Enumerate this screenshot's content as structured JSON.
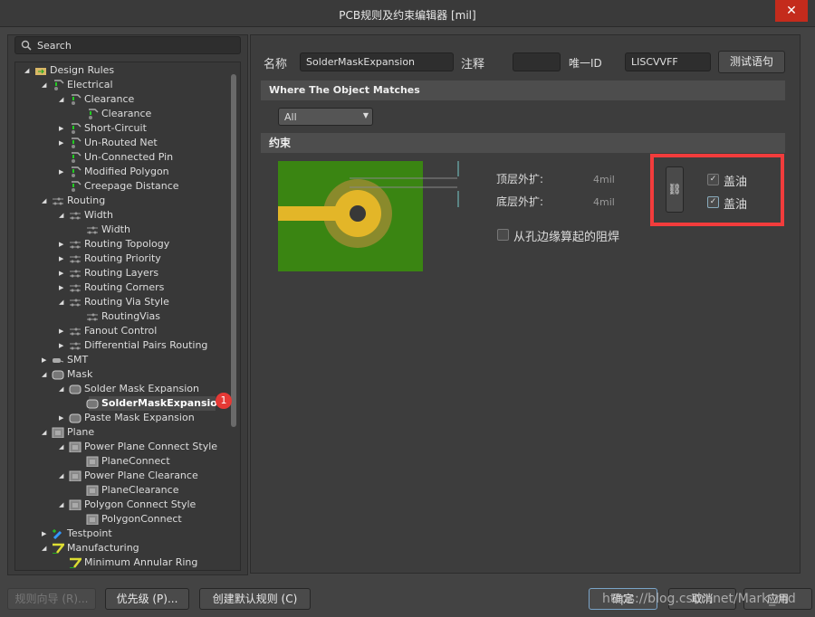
{
  "window": {
    "title": "PCB规则及约束编辑器 [mil]",
    "close": "✕"
  },
  "search": {
    "placeholder": "Search"
  },
  "tree": [
    {
      "label": "Design Rules",
      "level": 0,
      "arrow": "open",
      "icon": "folder"
    },
    {
      "label": "Electrical",
      "level": 1,
      "arrow": "open",
      "icon": "electrical"
    },
    {
      "label": "Clearance",
      "level": 2,
      "arrow": "open",
      "icon": "electrical"
    },
    {
      "label": "Clearance",
      "level": 3,
      "arrow": "none",
      "icon": "electrical"
    },
    {
      "label": "Short-Circuit",
      "level": 2,
      "arrow": "closed",
      "icon": "electrical"
    },
    {
      "label": "Un-Routed Net",
      "level": 2,
      "arrow": "closed",
      "icon": "electrical"
    },
    {
      "label": "Un-Connected Pin",
      "level": 2,
      "arrow": "none",
      "icon": "electrical"
    },
    {
      "label": "Modified Polygon",
      "level": 2,
      "arrow": "closed",
      "icon": "electrical"
    },
    {
      "label": "Creepage Distance",
      "level": 2,
      "arrow": "none",
      "icon": "electrical"
    },
    {
      "label": "Routing",
      "level": 1,
      "arrow": "open",
      "icon": "routing"
    },
    {
      "label": "Width",
      "level": 2,
      "arrow": "open",
      "icon": "routing"
    },
    {
      "label": "Width",
      "level": 3,
      "arrow": "none",
      "icon": "routing"
    },
    {
      "label": "Routing Topology",
      "level": 2,
      "arrow": "closed",
      "icon": "routing"
    },
    {
      "label": "Routing Priority",
      "level": 2,
      "arrow": "closed",
      "icon": "routing"
    },
    {
      "label": "Routing Layers",
      "level": 2,
      "arrow": "closed",
      "icon": "routing"
    },
    {
      "label": "Routing Corners",
      "level": 2,
      "arrow": "closed",
      "icon": "routing"
    },
    {
      "label": "Routing Via Style",
      "level": 2,
      "arrow": "open",
      "icon": "routing"
    },
    {
      "label": "RoutingVias",
      "level": 3,
      "arrow": "none",
      "icon": "routing"
    },
    {
      "label": "Fanout Control",
      "level": 2,
      "arrow": "closed",
      "icon": "routing"
    },
    {
      "label": "Differential Pairs Routing",
      "level": 2,
      "arrow": "closed",
      "icon": "routing"
    },
    {
      "label": "SMT",
      "level": 1,
      "arrow": "closed",
      "icon": "smt"
    },
    {
      "label": "Mask",
      "level": 1,
      "arrow": "open",
      "icon": "mask"
    },
    {
      "label": "Solder Mask Expansion",
      "level": 2,
      "arrow": "open",
      "icon": "mask"
    },
    {
      "label": "SolderMaskExpansion*",
      "level": 3,
      "arrow": "none",
      "icon": "mask",
      "selected": true
    },
    {
      "label": "Paste Mask Expansion",
      "level": 2,
      "arrow": "closed",
      "icon": "mask"
    },
    {
      "label": "Plane",
      "level": 1,
      "arrow": "open",
      "icon": "plane"
    },
    {
      "label": "Power Plane Connect Style",
      "level": 2,
      "arrow": "open",
      "icon": "plane"
    },
    {
      "label": "PlaneConnect",
      "level": 3,
      "arrow": "none",
      "icon": "plane"
    },
    {
      "label": "Power Plane Clearance",
      "level": 2,
      "arrow": "open",
      "icon": "plane"
    },
    {
      "label": "PlaneClearance",
      "level": 3,
      "arrow": "none",
      "icon": "plane"
    },
    {
      "label": "Polygon Connect Style",
      "level": 2,
      "arrow": "open",
      "icon": "plane"
    },
    {
      "label": "PolygonConnect",
      "level": 3,
      "arrow": "none",
      "icon": "plane"
    },
    {
      "label": "Testpoint",
      "level": 1,
      "arrow": "closed",
      "icon": "testpoint"
    },
    {
      "label": "Manufacturing",
      "level": 1,
      "arrow": "open",
      "icon": "manufacturing"
    },
    {
      "label": "Minimum Annular Ring",
      "level": 2,
      "arrow": "none",
      "icon": "manufacturing"
    }
  ],
  "badge": "1",
  "rule": {
    "name_label": "名称",
    "name_value": "SolderMaskExpansion",
    "comment_label": "注释",
    "comment_value": "",
    "id_label": "唯一ID",
    "id_value": "LISCVVFF",
    "test_button": "测试语句"
  },
  "match": {
    "header": "Where The Object Matches",
    "selected": "All"
  },
  "constraints": {
    "header": "约束",
    "top_label": "顶层外扩:",
    "top_value": "4mil",
    "bottom_label": "底层外扩:",
    "bottom_value": "4mil",
    "tent_top_label": "盖油",
    "tent_top_checked": true,
    "tent_bottom_label": "盖油",
    "tent_bottom_checked": true,
    "from_hole_label": "从孔边缘算起的阻焊",
    "from_hole_checked": false
  },
  "colors": {
    "board": "#3a8512",
    "pad": "#e3b628",
    "mask_ring": "#8a8a2c",
    "highlight": "#f23c3c"
  },
  "footer": {
    "wizard": "规则向导 (R)...",
    "priority": "优先级 (P)...",
    "create_default": "创建默认规则 (C)",
    "ok": "确定",
    "cancel": "取消",
    "apply": "应用",
    "watermark": "https://blog.csdn.net/Mark_md"
  }
}
